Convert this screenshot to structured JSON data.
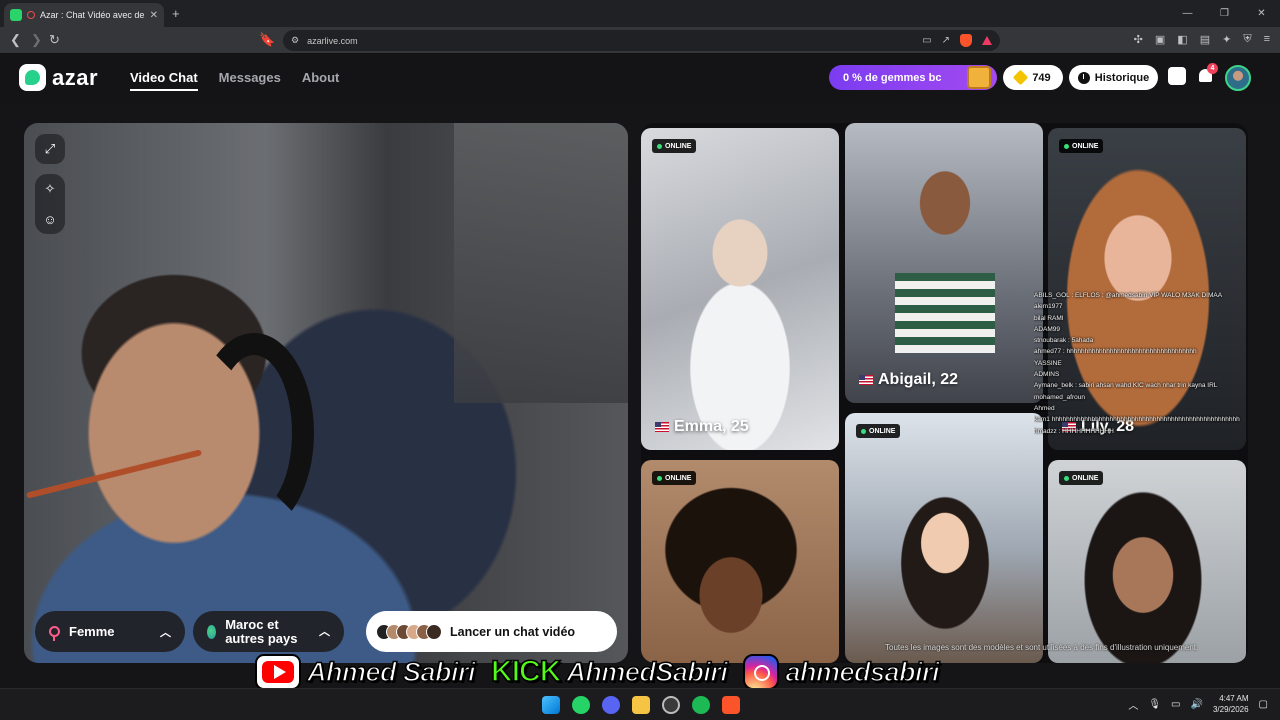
{
  "browser": {
    "tab_title": "Azar : Chat Vidéo avec de nou",
    "tab_close": "✕",
    "new_tab": "+",
    "url": "azarlive.com",
    "window_controls": [
      "—",
      "❐",
      "✕"
    ]
  },
  "app": {
    "logo_text": "azar",
    "nav": [
      "Video Chat",
      "Messages",
      "About"
    ],
    "gems_promo": "0 % de gemmes bc",
    "gem_count": "749",
    "history_label": "Historique",
    "notification_count": "4"
  },
  "camera": {
    "gender_filter": "Femme",
    "country_filter": "Maroc et autres pays",
    "start_button": "Lancer un chat vidéo"
  },
  "profiles": [
    {
      "badge": "ONLINE",
      "name": "Emma, 25"
    },
    {
      "badge": "",
      "name": "Abigail, 22"
    },
    {
      "badge": "ONLINE",
      "name": "Lily, 28"
    },
    {
      "badge": "ONLINE",
      "name": ""
    },
    {
      "badge": "ONLINE",
      "name": ""
    },
    {
      "badge": "ONLINE",
      "name": ""
    }
  ],
  "disclaimer": "Toutes les images sont des modèles et sont utilisées à des fins d'illustration uniquement.",
  "stream_chat": [
    "ABILS_GOL : ELFLOS : @ahmedsabiri VIP WALO M3AK DIMAA",
    "alem1977",
    "bilal RAMI",
    "ADAM99",
    "stnoubarak : 5ahada",
    "ahmed77 : hhhhhhhhhhhhhhhhhhhhhhhhhhhhhhhhhhhh",
    "YASSINE",
    "ADMINS",
    "Aymane_belk : sabiri ahsan wahd KIC wach nhar trin kayna IRL",
    "mohamed_afroun",
    "Ahmed",
    "kam1  hhhhhhhhhhhhhhhhhhhhhhhhhhhhhhhhhhhhhhhhhhhhhhhhhhhh",
    "hmadzz : HHHHHHHHHHH"
  ],
  "banner": {
    "youtube": "Ahmed Sabiri",
    "kick_logo": "KICK",
    "kick": "AhmedSabiri",
    "instagram": "ahmedsabiri"
  },
  "taskbar": {
    "time": "4:47 AM",
    "date": "3/29/2026"
  }
}
